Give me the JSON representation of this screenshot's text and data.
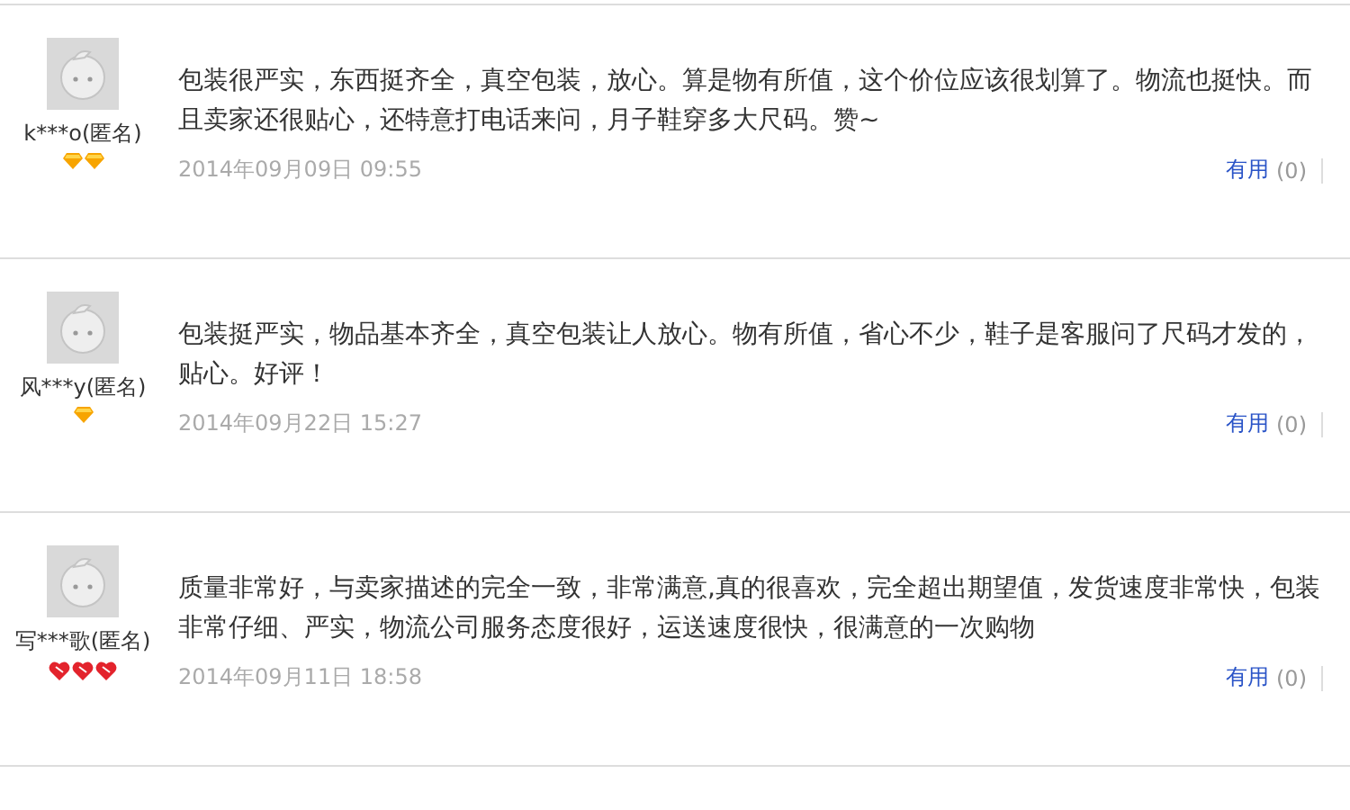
{
  "reviews": [
    {
      "user": "k***o(匿名)",
      "badges": [
        {
          "kind": "diamond"
        },
        {
          "kind": "diamond"
        }
      ],
      "text": "包装很严实，东西挺齐全，真空包装，放心。算是物有所值，这个价位应该很划算了。物流也挺快。而且卖家还很贴心，还特意打电话来问，月子鞋穿多大尺码。赞~",
      "date": "2014年09月09日 09:55",
      "useful_label": "有用",
      "useful_count": "(0)"
    },
    {
      "user": "风***y(匿名)",
      "badges": [
        {
          "kind": "diamond"
        }
      ],
      "text": "包装挺严实，物品基本齐全，真空包装让人放心。物有所值，省心不少，鞋子是客服问了尺码才发的，贴心。好评！",
      "date": "2014年09月22日 15:27",
      "useful_label": "有用",
      "useful_count": "(0)"
    },
    {
      "user": "写***歌(匿名)",
      "badges": [
        {
          "kind": "heart"
        },
        {
          "kind": "heart"
        },
        {
          "kind": "heart"
        }
      ],
      "text": "质量非常好，与卖家描述的完全一致，非常满意,真的很喜欢，完全超出期望值，发货速度非常快，包装非常仔细、严实，物流公司服务态度很好，运送速度很快，很满意的一次购物",
      "date": "2014年09月11日 18:58",
      "useful_label": "有用",
      "useful_count": "(0)"
    }
  ]
}
